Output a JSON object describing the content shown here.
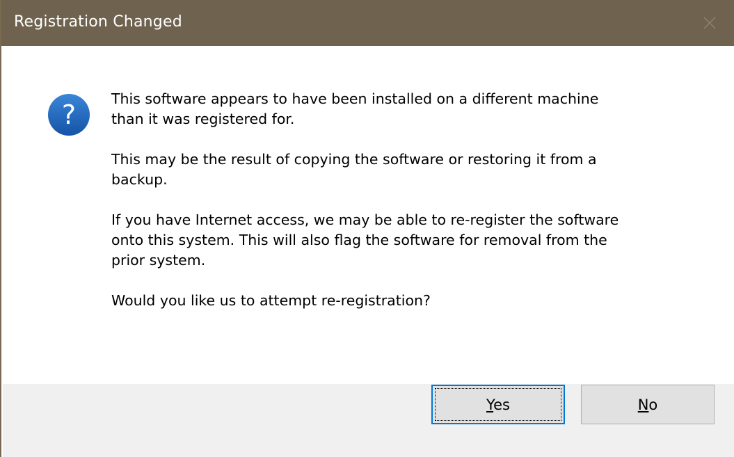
{
  "window": {
    "title": "Registration Changed",
    "close_icon": "close-icon"
  },
  "message": {
    "icon": "question-icon",
    "paragraphs": [
      "This software appears to have been installed on a different machine\nthan it was registered for.",
      "This may be the result of copying the software or restoring it from a\nbackup.",
      "If you have Internet access, we may be able to re-register the software\nonto this system.  This will also flag the software for removal from the\nprior system.",
      "Would you like us to attempt re-registration?"
    ]
  },
  "buttons": {
    "yes": {
      "mnemonic": "Y",
      "rest": "es"
    },
    "no": {
      "mnemonic": "N",
      "rest": "o"
    }
  },
  "colors": {
    "titlebar": "#6f6350",
    "icon_blue": "#1e63b8",
    "focus_border": "#0078d7",
    "footer": "#f0f0f0"
  }
}
